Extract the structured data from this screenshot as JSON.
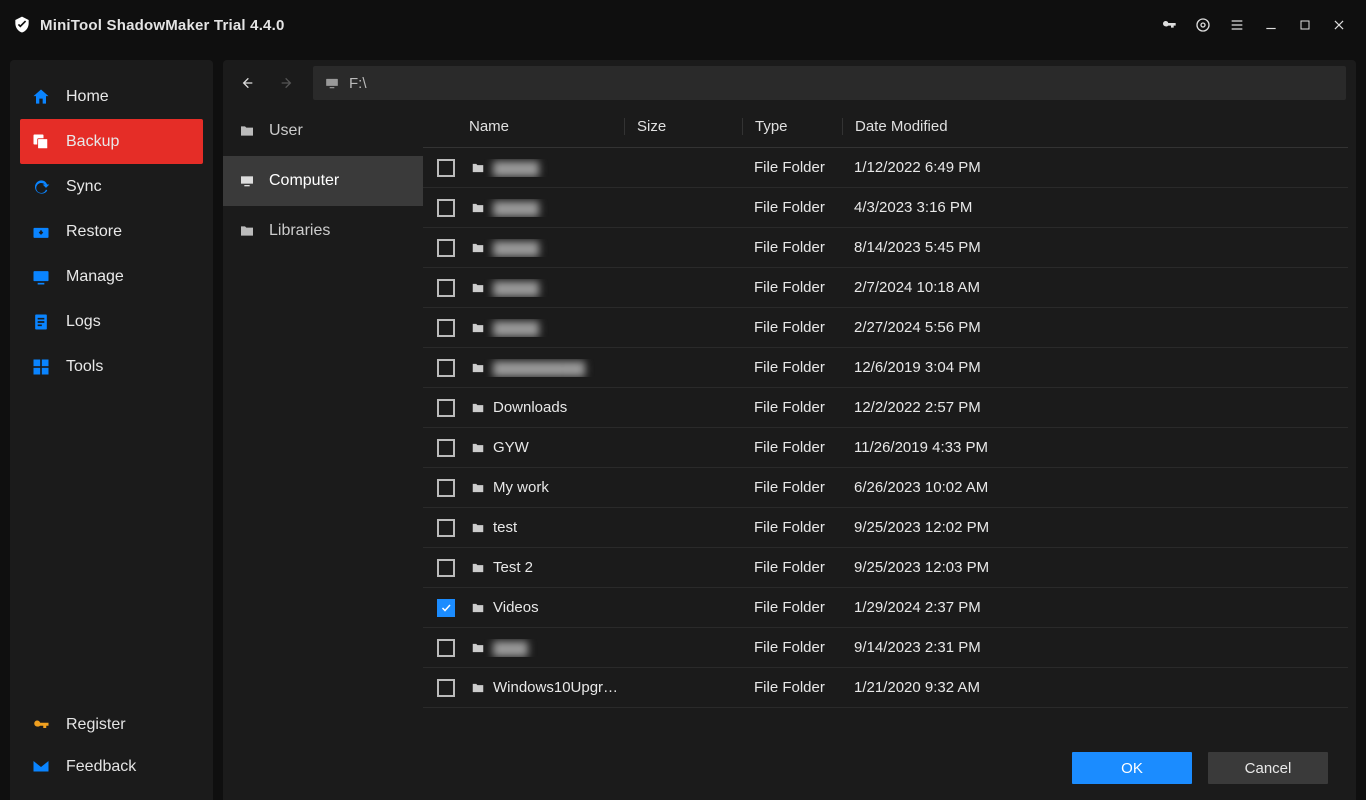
{
  "app_title": "MiniTool ShadowMaker Trial 4.4.0",
  "sidebar": {
    "items": [
      {
        "label": "Home"
      },
      {
        "label": "Backup"
      },
      {
        "label": "Sync"
      },
      {
        "label": "Restore"
      },
      {
        "label": "Manage"
      },
      {
        "label": "Logs"
      },
      {
        "label": "Tools"
      }
    ],
    "register": "Register",
    "feedback": "Feedback"
  },
  "path": "F:\\",
  "left_panel": {
    "user": "User",
    "computer": "Computer",
    "libraries": "Libraries"
  },
  "columns": {
    "name": "Name",
    "size": "Size",
    "type": "Type",
    "date": "Date Modified"
  },
  "rows": [
    {
      "name": "▇▇▇▇",
      "blurred": true,
      "checked": false,
      "type": "File Folder",
      "date": "1/12/2022 6:49 PM"
    },
    {
      "name": "▇▇▇▇",
      "blurred": true,
      "checked": false,
      "type": "File Folder",
      "date": "4/3/2023 3:16 PM"
    },
    {
      "name": "▇▇▇▇",
      "blurred": true,
      "checked": false,
      "type": "File Folder",
      "date": "8/14/2023 5:45 PM"
    },
    {
      "name": "▇▇▇▇",
      "blurred": true,
      "checked": false,
      "type": "File Folder",
      "date": "2/7/2024 10:18 AM"
    },
    {
      "name": "▇▇▇▇",
      "blurred": true,
      "checked": false,
      "type": "File Folder",
      "date": "2/27/2024 5:56 PM"
    },
    {
      "name": "▇▇▇▇▇▇▇▇",
      "blurred": true,
      "checked": false,
      "type": "File Folder",
      "date": "12/6/2019 3:04 PM"
    },
    {
      "name": "Downloads",
      "blurred": false,
      "checked": false,
      "type": "File Folder",
      "date": "12/2/2022 2:57 PM"
    },
    {
      "name": "GYW",
      "blurred": false,
      "checked": false,
      "type": "File Folder",
      "date": "11/26/2019 4:33 PM"
    },
    {
      "name": "My work",
      "blurred": false,
      "checked": false,
      "type": "File Folder",
      "date": "6/26/2023 10:02 AM"
    },
    {
      "name": "test",
      "blurred": false,
      "checked": false,
      "type": "File Folder",
      "date": "9/25/2023 12:02 PM"
    },
    {
      "name": "Test 2",
      "blurred": false,
      "checked": false,
      "type": "File Folder",
      "date": "9/25/2023 12:03 PM"
    },
    {
      "name": "Videos",
      "blurred": false,
      "checked": true,
      "type": "File Folder",
      "date": "1/29/2024 2:37 PM"
    },
    {
      "name": "▇▇▇",
      "blurred": true,
      "checked": false,
      "type": "File Folder",
      "date": "9/14/2023 2:31 PM"
    },
    {
      "name": "Windows10Upgr…",
      "blurred": false,
      "checked": false,
      "type": "File Folder",
      "date": "1/21/2020 9:32 AM"
    }
  ],
  "buttons": {
    "ok": "OK",
    "cancel": "Cancel"
  }
}
